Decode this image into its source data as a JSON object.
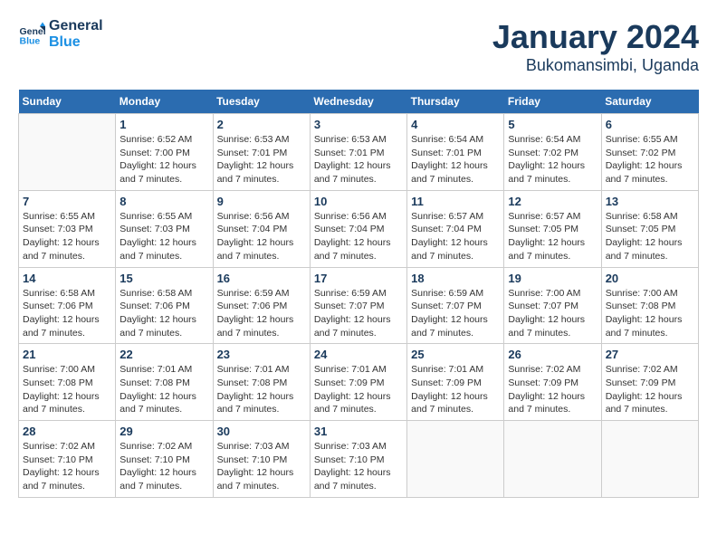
{
  "header": {
    "logo_line1": "General",
    "logo_line2": "Blue",
    "month": "January 2024",
    "location": "Bukomansimbi, Uganda"
  },
  "days_of_week": [
    "Sunday",
    "Monday",
    "Tuesday",
    "Wednesday",
    "Thursday",
    "Friday",
    "Saturday"
  ],
  "weeks": [
    [
      {
        "day": "",
        "info": ""
      },
      {
        "day": "1",
        "info": "Sunrise: 6:52 AM\nSunset: 7:00 PM\nDaylight: 12 hours\nand 7 minutes."
      },
      {
        "day": "2",
        "info": "Sunrise: 6:53 AM\nSunset: 7:01 PM\nDaylight: 12 hours\nand 7 minutes."
      },
      {
        "day": "3",
        "info": "Sunrise: 6:53 AM\nSunset: 7:01 PM\nDaylight: 12 hours\nand 7 minutes."
      },
      {
        "day": "4",
        "info": "Sunrise: 6:54 AM\nSunset: 7:01 PM\nDaylight: 12 hours\nand 7 minutes."
      },
      {
        "day": "5",
        "info": "Sunrise: 6:54 AM\nSunset: 7:02 PM\nDaylight: 12 hours\nand 7 minutes."
      },
      {
        "day": "6",
        "info": "Sunrise: 6:55 AM\nSunset: 7:02 PM\nDaylight: 12 hours\nand 7 minutes."
      }
    ],
    [
      {
        "day": "7",
        "info": "Sunrise: 6:55 AM\nSunset: 7:03 PM\nDaylight: 12 hours\nand 7 minutes."
      },
      {
        "day": "8",
        "info": "Sunrise: 6:55 AM\nSunset: 7:03 PM\nDaylight: 12 hours\nand 7 minutes."
      },
      {
        "day": "9",
        "info": "Sunrise: 6:56 AM\nSunset: 7:04 PM\nDaylight: 12 hours\nand 7 minutes."
      },
      {
        "day": "10",
        "info": "Sunrise: 6:56 AM\nSunset: 7:04 PM\nDaylight: 12 hours\nand 7 minutes."
      },
      {
        "day": "11",
        "info": "Sunrise: 6:57 AM\nSunset: 7:04 PM\nDaylight: 12 hours\nand 7 minutes."
      },
      {
        "day": "12",
        "info": "Sunrise: 6:57 AM\nSunset: 7:05 PM\nDaylight: 12 hours\nand 7 minutes."
      },
      {
        "day": "13",
        "info": "Sunrise: 6:58 AM\nSunset: 7:05 PM\nDaylight: 12 hours\nand 7 minutes."
      }
    ],
    [
      {
        "day": "14",
        "info": "Sunrise: 6:58 AM\nSunset: 7:06 PM\nDaylight: 12 hours\nand 7 minutes."
      },
      {
        "day": "15",
        "info": "Sunrise: 6:58 AM\nSunset: 7:06 PM\nDaylight: 12 hours\nand 7 minutes."
      },
      {
        "day": "16",
        "info": "Sunrise: 6:59 AM\nSunset: 7:06 PM\nDaylight: 12 hours\nand 7 minutes."
      },
      {
        "day": "17",
        "info": "Sunrise: 6:59 AM\nSunset: 7:07 PM\nDaylight: 12 hours\nand 7 minutes."
      },
      {
        "day": "18",
        "info": "Sunrise: 6:59 AM\nSunset: 7:07 PM\nDaylight: 12 hours\nand 7 minutes."
      },
      {
        "day": "19",
        "info": "Sunrise: 7:00 AM\nSunset: 7:07 PM\nDaylight: 12 hours\nand 7 minutes."
      },
      {
        "day": "20",
        "info": "Sunrise: 7:00 AM\nSunset: 7:08 PM\nDaylight: 12 hours\nand 7 minutes."
      }
    ],
    [
      {
        "day": "21",
        "info": "Sunrise: 7:00 AM\nSunset: 7:08 PM\nDaylight: 12 hours\nand 7 minutes."
      },
      {
        "day": "22",
        "info": "Sunrise: 7:01 AM\nSunset: 7:08 PM\nDaylight: 12 hours\nand 7 minutes."
      },
      {
        "day": "23",
        "info": "Sunrise: 7:01 AM\nSunset: 7:08 PM\nDaylight: 12 hours\nand 7 minutes."
      },
      {
        "day": "24",
        "info": "Sunrise: 7:01 AM\nSunset: 7:09 PM\nDaylight: 12 hours\nand 7 minutes."
      },
      {
        "day": "25",
        "info": "Sunrise: 7:01 AM\nSunset: 7:09 PM\nDaylight: 12 hours\nand 7 minutes."
      },
      {
        "day": "26",
        "info": "Sunrise: 7:02 AM\nSunset: 7:09 PM\nDaylight: 12 hours\nand 7 minutes."
      },
      {
        "day": "27",
        "info": "Sunrise: 7:02 AM\nSunset: 7:09 PM\nDaylight: 12 hours\nand 7 minutes."
      }
    ],
    [
      {
        "day": "28",
        "info": "Sunrise: 7:02 AM\nSunset: 7:10 PM\nDaylight: 12 hours\nand 7 minutes."
      },
      {
        "day": "29",
        "info": "Sunrise: 7:02 AM\nSunset: 7:10 PM\nDaylight: 12 hours\nand 7 minutes."
      },
      {
        "day": "30",
        "info": "Sunrise: 7:03 AM\nSunset: 7:10 PM\nDaylight: 12 hours\nand 7 minutes."
      },
      {
        "day": "31",
        "info": "Sunrise: 7:03 AM\nSunset: 7:10 PM\nDaylight: 12 hours\nand 7 minutes."
      },
      {
        "day": "",
        "info": ""
      },
      {
        "day": "",
        "info": ""
      },
      {
        "day": "",
        "info": ""
      }
    ]
  ]
}
